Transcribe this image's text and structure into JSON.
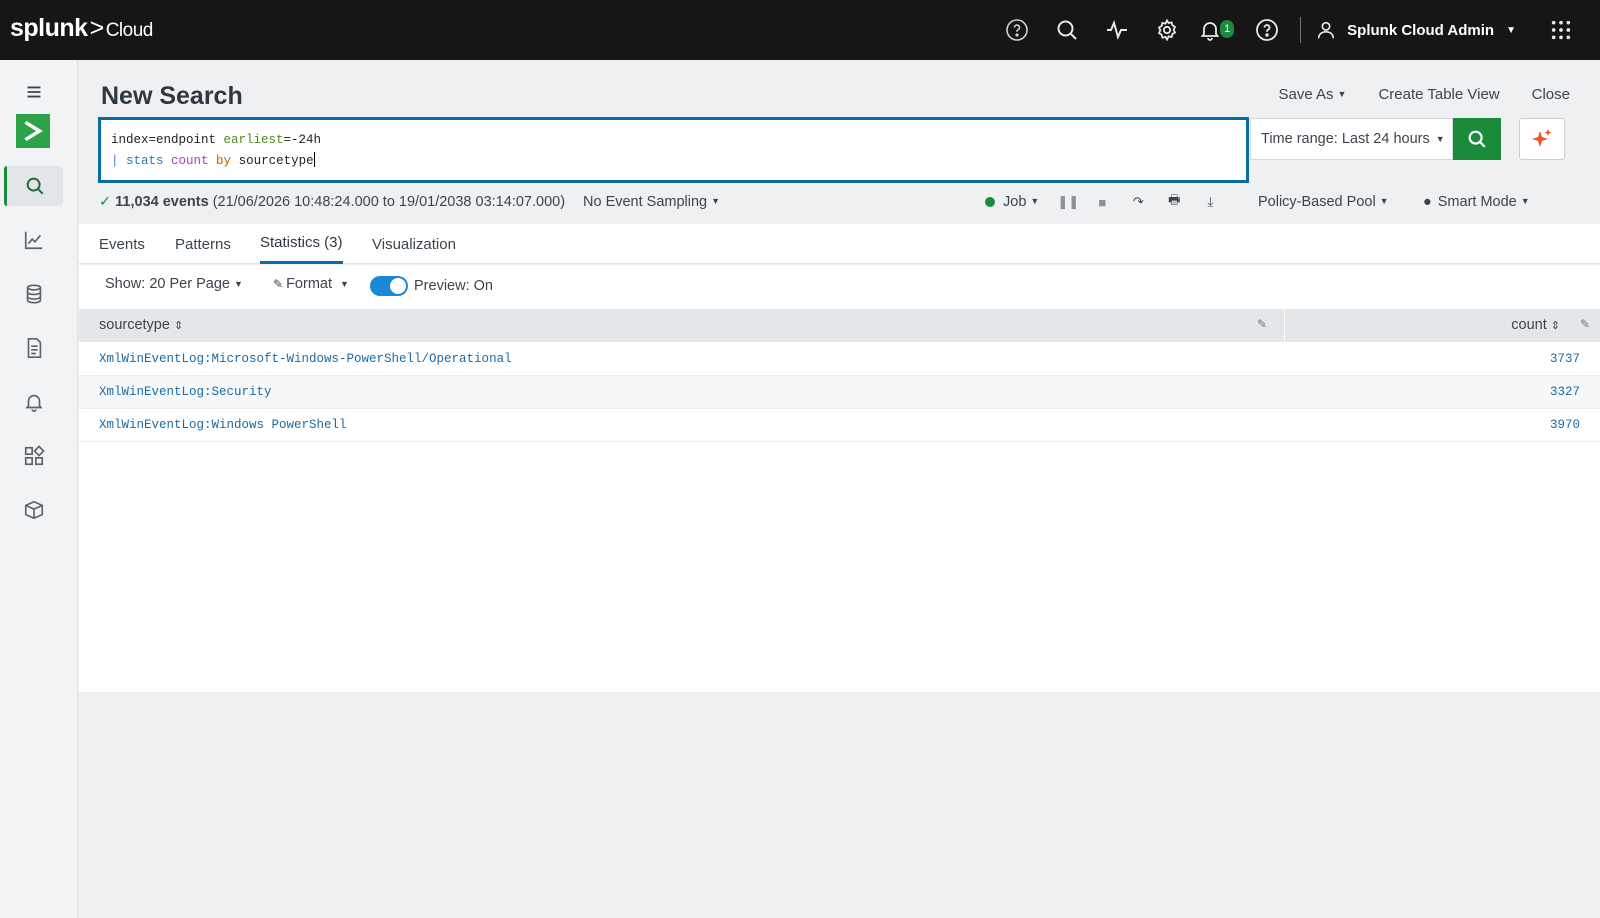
{
  "topbar": {
    "logo_brand": "splunk",
    "logo_sep": ">",
    "logo_product": "Cloud",
    "notification_count": "1",
    "user_name": "Splunk Cloud Admin"
  },
  "rail": {
    "items": [
      "menu-icon",
      "search-icon",
      "chart-line-icon",
      "database-icon",
      "document-icon",
      "bell-icon",
      "dashboard-grid-icon",
      "package-icon"
    ]
  },
  "page": {
    "title": "New Search",
    "actions": {
      "save_as": "Save As",
      "create_table_view": "Create Table View",
      "close": "Close"
    }
  },
  "search": {
    "line1_index": "index=endpoint ",
    "line1_kw": "earliest",
    "line1_rest": "=-24h",
    "line2_pipe": "| ",
    "line2_cmd": "stats",
    "line2_fn": " count",
    "line2_by": " by",
    "line2_rest": " sourcetype"
  },
  "time_range": {
    "label": "Time range: Last 24 hours"
  },
  "status": {
    "check": "✓",
    "events": "11,034 events",
    "range": "(21/06/2026 10:48:24.000 to 19/01/2038 03:14:07.000)",
    "sampling": "No Event Sampling",
    "job": "Job",
    "pool": "Policy-Based Pool",
    "mode": "Smart Mode"
  },
  "tabs": [
    "Events",
    "Patterns",
    "Statistics (3)",
    "Visualization"
  ],
  "toolbar": {
    "show": "Show: 20 Per Page",
    "format": "Format",
    "preview": "Preview: On"
  },
  "table": {
    "columns": [
      "sourcetype",
      "count"
    ],
    "rows": [
      {
        "sourcetype": "XmlWinEventLog:Microsoft-Windows-PowerShell/Operational",
        "count": "3737"
      },
      {
        "sourcetype": "XmlWinEventLog:Security",
        "count": "3327"
      },
      {
        "sourcetype": "XmlWinEventLog:Windows PowerShell",
        "count": "3970"
      }
    ]
  },
  "colors": {
    "accent_green": "#1b8a3a",
    "accent_blue": "#0b6ba8",
    "topbar_bg": "#161616"
  }
}
